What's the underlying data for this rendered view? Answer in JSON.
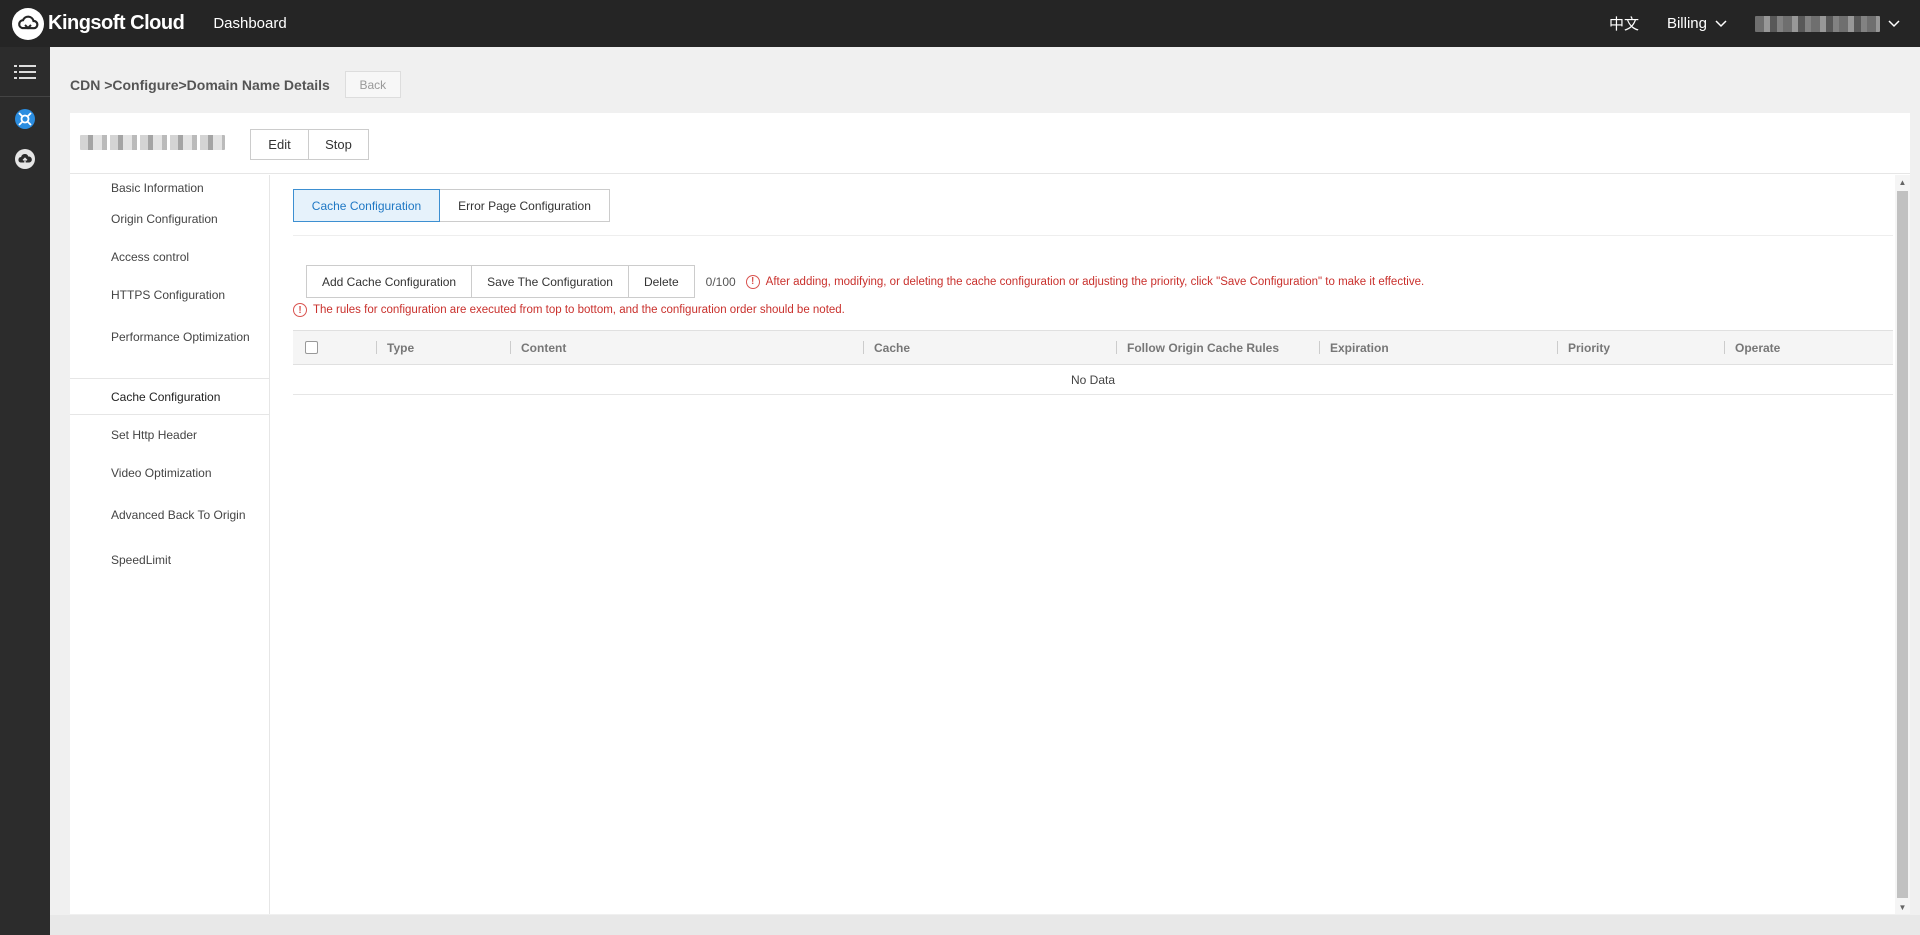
{
  "brand": {
    "name": "Kingsoft Cloud"
  },
  "topnav": {
    "dashboard": "Dashboard",
    "language": "中文",
    "billing": "Billing",
    "chevron": "chevron-down-icon"
  },
  "iconbar": {
    "icons": [
      "menu-icon",
      "cdn-icon",
      "cloud-upload-icon"
    ],
    "accent": "#2b8de0"
  },
  "breadcrumb": "CDN >Configure>Domain Name Details",
  "back_label": "Back",
  "header": {
    "edit_label": "Edit",
    "stop_label": "Stop"
  },
  "sidebar": {
    "items": [
      {
        "label": "Basic Information"
      },
      {
        "label": "Origin Configuration"
      },
      {
        "label": "Access control"
      },
      {
        "label": "HTTPS Configuration"
      },
      {
        "label": "Performance Optimization"
      },
      {
        "label": "Cache Configuration",
        "active": true
      },
      {
        "label": "Set Http Header"
      },
      {
        "label": "Video Optimization"
      },
      {
        "label": "Advanced Back To Origin"
      },
      {
        "label": "SpeedLimit"
      }
    ]
  },
  "tabs": [
    {
      "label": "Cache Configuration",
      "active": true
    },
    {
      "label": "Error Page Configuration"
    }
  ],
  "actions": {
    "add": "Add Cache Configuration",
    "save": "Save The Configuration",
    "delete": "Delete",
    "count": "0/100"
  },
  "notices": {
    "save_hint": "After adding, modifying, or deleting the cache configuration or adjusting the priority, click \"Save Configuration\" to make it effective.",
    "order_hint": "The rules for configuration are executed from top to bottom, and the configuration order should be noted.",
    "color": "#c9302c"
  },
  "table": {
    "columns": [
      "Type",
      "Content",
      "Cache",
      "Follow Origin Cache Rules",
      "Expiration",
      "Priority",
      "Operate"
    ],
    "empty_text": "No Data"
  }
}
